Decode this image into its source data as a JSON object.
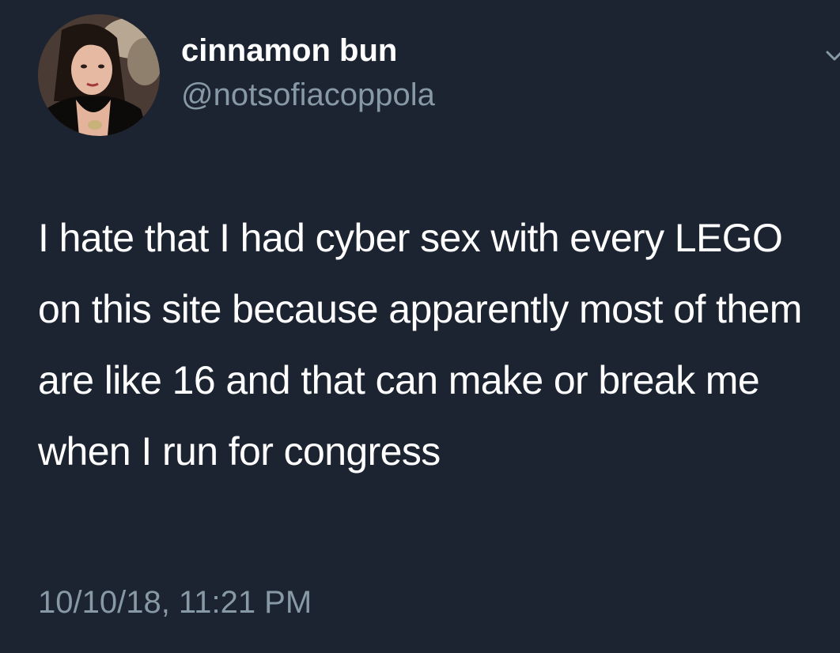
{
  "colors": {
    "background": "#1c2331",
    "primary_text": "#ffffff",
    "secondary_text": "#8899a6"
  },
  "author": {
    "display_name": "cinnamon bun",
    "handle": "@notsofiacoppola",
    "avatar_icon": "profile-photo"
  },
  "tweet": {
    "text": "I hate that I had cyber sex with every LEGO on this site because apparently most of them are like 16 and that can make or break me when I run for congress",
    "timestamp": "10/10/18, 11:21 PM"
  },
  "menu_icon": "chevron-down-icon"
}
